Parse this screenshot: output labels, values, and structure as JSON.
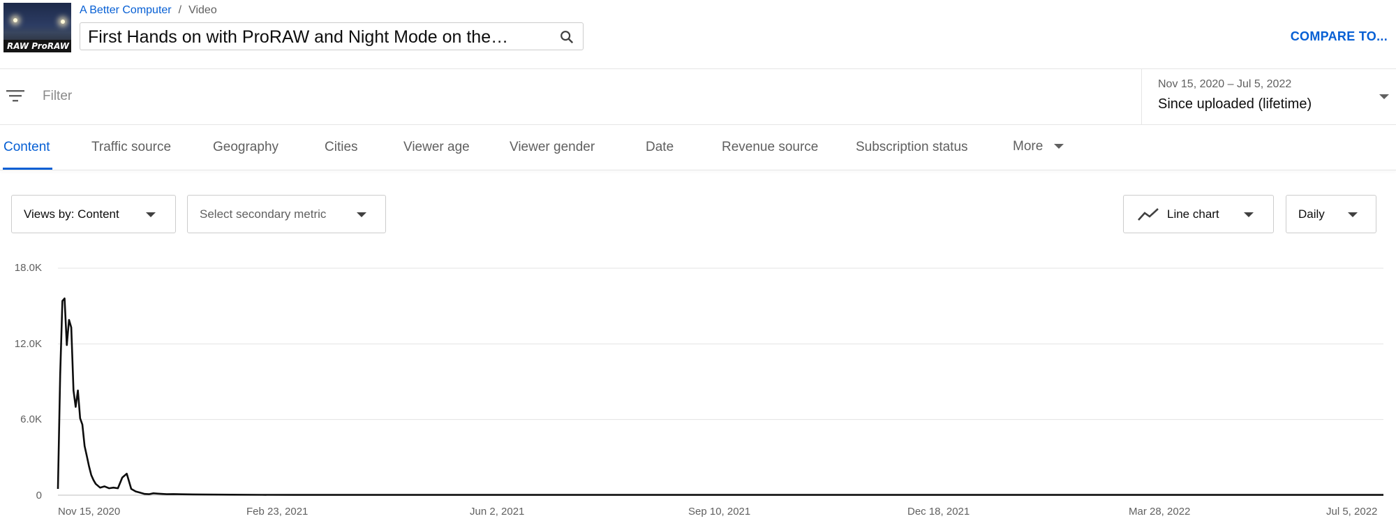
{
  "header": {
    "thumbnail_text_left": "RAW",
    "thumbnail_text_right": "ProRAW",
    "breadcrumb_channel": "A Better Computer",
    "breadcrumb_separator": "/",
    "breadcrumb_page": "Video",
    "video_title": "First Hands on with ProRAW and Night Mode on the…",
    "compare_label": "COMPARE TO..."
  },
  "filter": {
    "placeholder": "Filter",
    "date_range": "Nov 15, 2020 – Jul 5, 2022",
    "period_label": "Since uploaded (lifetime)"
  },
  "tabs": [
    {
      "label": "Content",
      "active": true
    },
    {
      "label": "Traffic source"
    },
    {
      "label": "Geography"
    },
    {
      "label": "Cities"
    },
    {
      "label": "Viewer age"
    },
    {
      "label": "Viewer gender"
    },
    {
      "label": "Date"
    },
    {
      "label": "Revenue source"
    },
    {
      "label": "Subscription status"
    },
    {
      "label": "More"
    }
  ],
  "controls": {
    "primary_metric": "Views by: Content",
    "secondary_metric": "Select secondary metric",
    "chart_type": "Line chart",
    "interval": "Daily"
  },
  "colors": {
    "accent": "#065fd4",
    "line": "#0d0d0d"
  },
  "chart_data": {
    "type": "line",
    "xlabel": "",
    "ylabel": "",
    "ylim": [
      0,
      18000
    ],
    "y_ticks": [
      "0",
      "6.0K",
      "12.0K",
      "18.0K"
    ],
    "x_tick_labels": [
      "Nov 15, 2020",
      "Feb 23, 2021",
      "Jun 2, 2021",
      "Sep 10, 2021",
      "Dec 18, 2021",
      "Mar 28, 2022",
      "Jul 5, 2022"
    ],
    "x_range": [
      "2020-11-15",
      "2022-07-05"
    ],
    "grid": true,
    "series": [
      {
        "x": [
          "2020-11-15",
          "2020-11-16",
          "2020-11-17",
          "2020-11-18",
          "2020-11-19",
          "2020-11-20",
          "2020-11-21",
          "2020-11-22",
          "2020-11-23",
          "2020-11-24",
          "2020-11-25",
          "2020-11-26",
          "2020-11-27",
          "2020-11-28",
          "2020-11-29",
          "2020-11-30",
          "2020-12-01",
          "2020-12-02",
          "2020-12-04",
          "2020-12-06",
          "2020-12-08",
          "2020-12-10",
          "2020-12-12",
          "2020-12-14",
          "2020-12-16",
          "2020-12-18",
          "2020-12-20",
          "2020-12-22",
          "2020-12-24",
          "2020-12-26",
          "2020-12-28",
          "2020-12-30",
          "2021-01-01",
          "2021-01-03",
          "2021-01-06",
          "2021-01-10",
          "2021-01-15",
          "2021-01-20",
          "2021-02-01",
          "2021-02-15",
          "2021-03-01",
          "2022-07-05"
        ],
        "values": [
          500,
          9500,
          15400,
          15600,
          11900,
          13900,
          13300,
          8300,
          7000,
          8300,
          6100,
          5600,
          3900,
          3100,
          2300,
          1600,
          1200,
          900,
          600,
          700,
          550,
          600,
          550,
          1400,
          1700,
          500,
          300,
          200,
          100,
          80,
          150,
          120,
          100,
          80,
          90,
          70,
          60,
          50,
          40,
          30,
          20,
          20
        ]
      }
    ]
  }
}
